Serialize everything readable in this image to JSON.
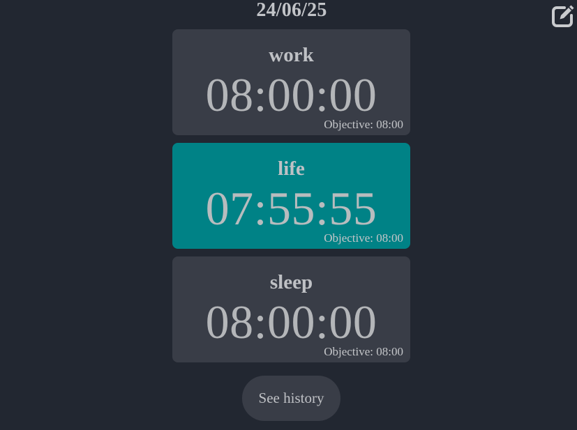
{
  "header": {
    "date": "24/06/25",
    "edit_icon": "edit-icon"
  },
  "cards": [
    {
      "name": "work",
      "time": "08:00:00",
      "objective": "Objective: 08:00",
      "active": false
    },
    {
      "name": "life",
      "time": "07:55:55",
      "objective": "Objective: 08:00",
      "active": true
    },
    {
      "name": "sleep",
      "time": "08:00:00",
      "objective": "Objective: 08:00",
      "active": false
    }
  ],
  "footer": {
    "history_label": "See history"
  },
  "colors": {
    "background": "#222731",
    "card": "#393d47",
    "active_card": "#008286",
    "text": "#b9bcc0"
  }
}
